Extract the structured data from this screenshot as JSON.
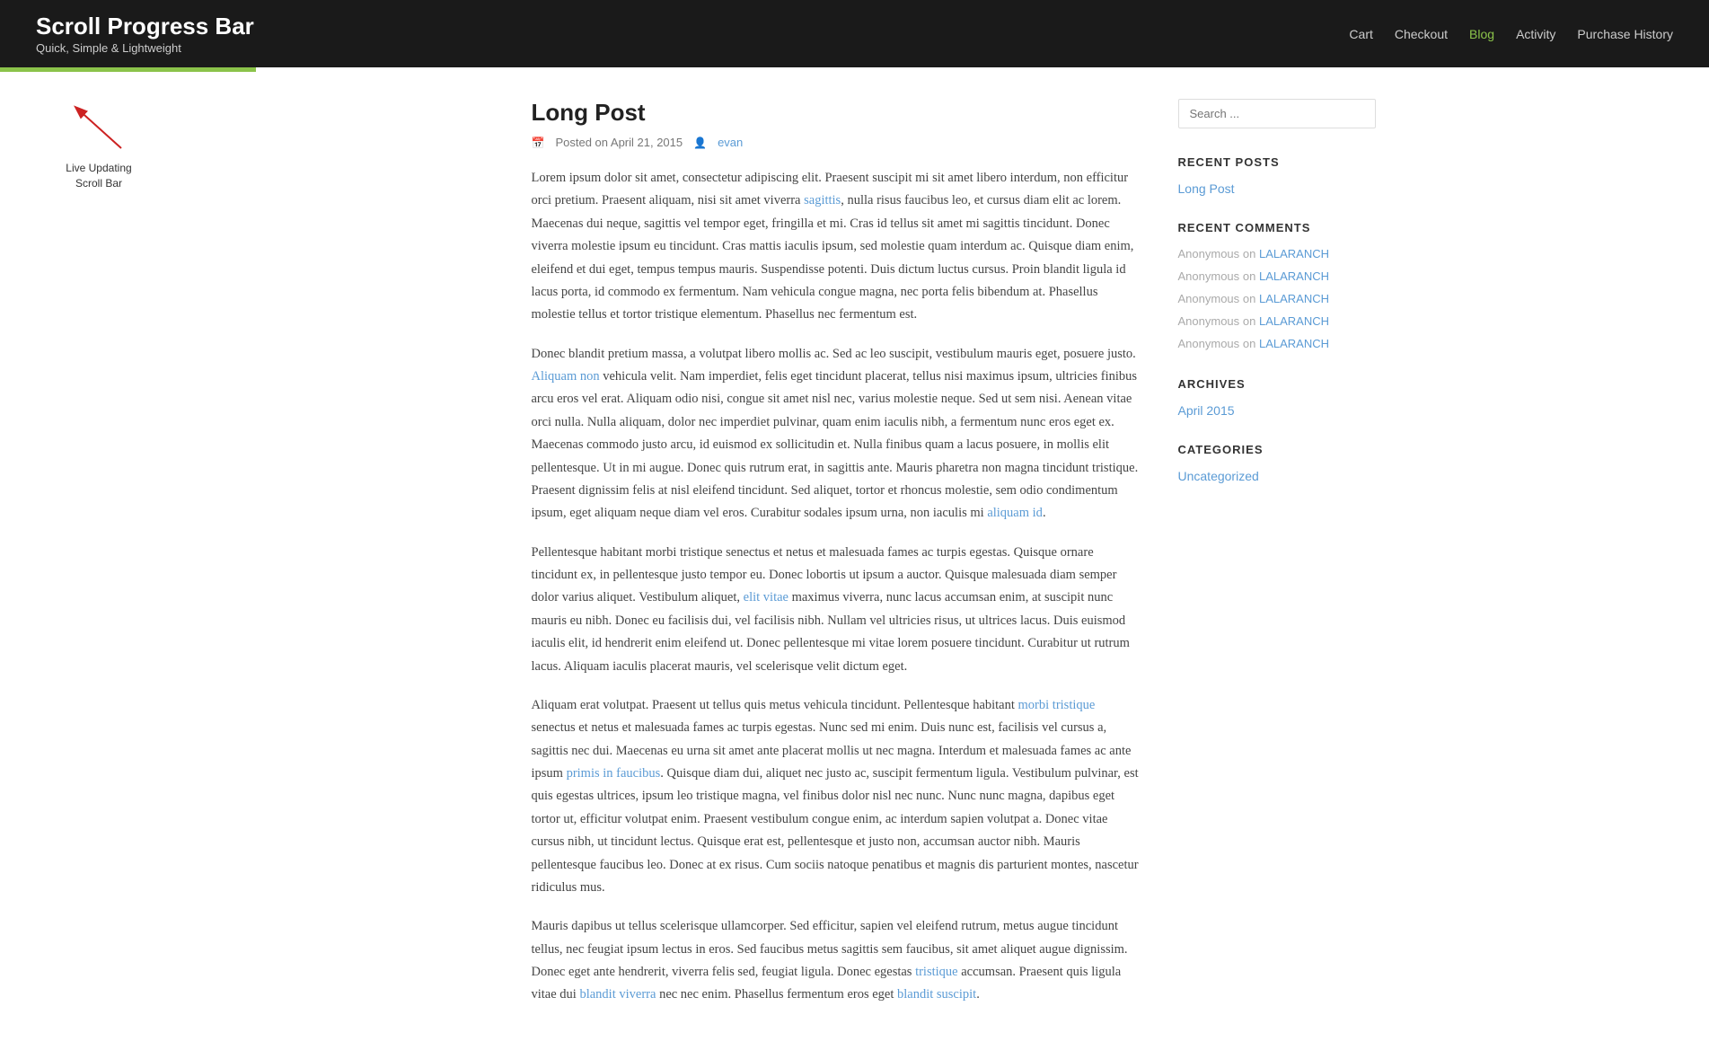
{
  "header": {
    "site_title": "Scroll Progress Bar",
    "site_tagline": "Quick, Simple & Lightweight",
    "nav": [
      {
        "label": "Cart",
        "active": false
      },
      {
        "label": "Checkout",
        "active": false
      },
      {
        "label": "Blog",
        "active": true
      },
      {
        "label": "Activity",
        "active": false
      },
      {
        "label": "Purchase History",
        "active": false
      }
    ]
  },
  "scroll_bar": {
    "label": "Live Updating\nScroll Bar",
    "progress_percent": 15
  },
  "post": {
    "title": "Long Post",
    "date": "Posted on April 21, 2015",
    "author": "evan",
    "paragraphs": [
      "Lorem ipsum dolor sit amet, consectetur adipiscing elit. Praesent suscipit mi sit amet libero interdum, non efficitur orci pretium. Praesent aliquam, nisi sit amet viverra sagittis, nulla risus faucibus leo, et cursus diam elit ac lorem. Maecenas dui neque, sagittis vel tempor eget, fringilla et mi. Cras id tellus sit amet mi sagittis tincidunt. Donec viverra molestie ipsum eu tincidunt. Cras mattis iaculis ipsum, sed molestie quam interdum ac. Quisque diam enim, eleifend et dui eget, tempus tempus mauris. Suspendisse potenti. Duis dictum luctus cursus. Proin blandit ligula id lacus porta, id commodo ex fermentum. Nam vehicula congue magna, nec porta felis bibendum at. Phasellus molestie tellus et tortor tristique elementum. Phasellus nec fermentum est.",
      "Donec blandit pretium massa, a volutpat libero mollis ac. Sed ac leo suscipit, vestibulum mauris eget, posuere justo. Aliquam non vehicula velit. Nam imperdiet, felis eget tincidunt placerat, tellus nisi maximus ipsum, ultricies finibus arcu eros vel erat. Aliquam odio nisi, congue sit amet nisl nec, varius molestie neque. Sed ut sem nisi. Aenean vitae orci nulla. Nulla aliquam, dolor nec imperdiet pulvinar, quam enim iaculis nibh, a fermentum nunc eros eget ex. Maecenas commodo justo arcu, id euismod ex sollicitudin et. Nulla finibus quam a lacus posuere, in mollis elit pellentesque. Ut in mi augue. Donec quis rutrum erat, in sagittis ante. Mauris pharetra non magna tincidunt tristique. Praesent dignissim felis at nisl eleifend tincidunt. Sed aliquet, tortor et rhoncus molestie, sem odio condimentum ipsum, eget aliquam neque diam vel eros. Curabitur sodales ipsum urna, non iaculis mi aliquam id.",
      "Pellentesque habitant morbi tristique senectus et netus et malesuada fames ac turpis egestas. Quisque ornare tincidunt ex, in pellentesque justo tempor eu. Donec lobortis ut ipsum a auctor. Quisque malesuada diam semper dolor varius aliquet. Vestibulum aliquet, elit vitae maximus viverra, nunc lacus accumsan enim, at suscipit nunc mauris eu nibh. Donec eu facilisis dui, vel facilisis nibh. Nullam vel ultricies risus, ut ultrices lacus. Duis euismod iaculis elit, id hendrerit enim eleifend ut. Donec pellentesque mi vitae lorem posuere tincidunt. Curabitur ut rutrum lacus. Aliquam iaculis placerat mauris, vel scelerisque velit dictum eget.",
      "Aliquam erat volutpat. Praesent ut tellus quis metus vehicula tincidunt. Pellentesque habitant morbi tristique senectus et netus et malesuada fames ac turpis egestas. Nunc sed mi enim. Duis nunc est, facilisis vel cursus a, sagittis nec dui. Maecenas eu urna sit amet ante placerat mollis ut nec magna. Interdum et malesuada fames ac ante ipsum primis in faucibus. Quisque diam dui, aliquet nec justo ac, suscipit fermentum ligula. Vestibulum pulvinar, est quis egestas ultrices, ipsum leo tristique magna, vel finibus dolor nisl nec nunc. Nunc nunc magna, dapibus eget tortor ut, efficitur volutpat enim. Praesent vestibulum congue enim, ac interdum sapien volutpat a. Donec vitae cursus nibh, ut tincidunt lectus. Quisque erat est, pellentesque et justo non, accumsan auctor nibh. Mauris pellentesque faucibus leo. Donec at ex risus. Cum sociis natoque penatibus et magnis dis parturient montes, nascetur ridiculus mus.",
      "Mauris dapibus ut tellus scelerisque ullamcorper. Sed efficitur, sapien vel eleifend rutrum, metus augue tincidunt tellus, nec feugiat ipsum lectus in eros. Sed faucibus metus sagittis sem faucibus, sit amet aliquet augue dignissim. Donec eget ante hendrerit, viverra felis sed, feugiat ligula. Donec egestas tristique accumsan. Praesent quis ligula vitae dui blandit viverra nec nec enim. Phasellus fermentum eros eget blandit suscipit."
    ]
  },
  "sidebar": {
    "search_placeholder": "Search ...",
    "recent_posts_title": "RECENT POSTS",
    "recent_posts": [
      {
        "label": "Long Post"
      }
    ],
    "recent_comments_title": "RECENT COMMENTS",
    "recent_comments": [
      {
        "author": "Anonymous",
        "sep": "on",
        "link": "LALARANCH"
      },
      {
        "author": "Anonymous",
        "sep": "on",
        "link": "LALARANCH"
      },
      {
        "author": "Anonymous",
        "sep": "on",
        "link": "LALARANCH"
      },
      {
        "author": "Anonymous",
        "sep": "on",
        "link": "LALARANCH"
      },
      {
        "author": "Anonymous",
        "sep": "on",
        "link": "LALARANCH"
      }
    ],
    "archives_title": "ARCHIVES",
    "archives": [
      {
        "label": "April 2015"
      }
    ],
    "categories_title": "CATEGORIES",
    "categories": [
      {
        "label": "Uncategorized"
      }
    ]
  }
}
